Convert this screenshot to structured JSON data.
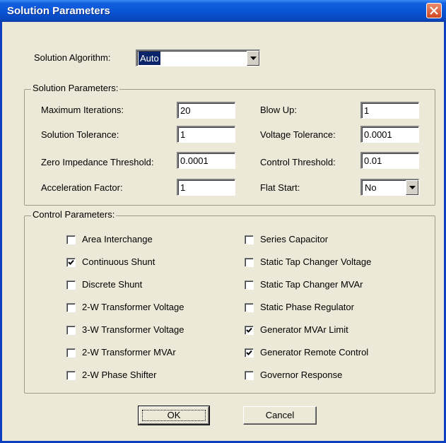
{
  "window": {
    "title": "Solution Parameters"
  },
  "algorithm": {
    "label": "Solution Algorithm:",
    "value": "Auto"
  },
  "solution_group": {
    "title": "Solution Parameters:",
    "max_iterations": {
      "label": "Maximum Iterations:",
      "value": "20"
    },
    "solution_tolerance": {
      "label": "Solution Tolerance:",
      "value": "1"
    },
    "zero_impedance": {
      "label": "Zero Impedance Threshold:",
      "value": "0.0001"
    },
    "acceleration": {
      "label": "Acceleration Factor:",
      "value": "1"
    },
    "blow_up": {
      "label": "Blow Up:",
      "value": "1"
    },
    "voltage_tolerance": {
      "label": "Voltage Tolerance:",
      "value": "0.0001"
    },
    "control_threshold": {
      "label": "Control Threshold:",
      "value": "0.01"
    },
    "flat_start": {
      "label": "Flat Start:",
      "value": "No"
    }
  },
  "control_group": {
    "title": "Control Parameters:",
    "left": [
      {
        "label": "Area Interchange",
        "checked": false
      },
      {
        "label": "Continuous Shunt",
        "checked": true
      },
      {
        "label": "Discrete Shunt",
        "checked": false
      },
      {
        "label": "2-W Transformer Voltage",
        "checked": false
      },
      {
        "label": "3-W Transformer Voltage",
        "checked": false
      },
      {
        "label": "2-W Transformer MVAr",
        "checked": false
      },
      {
        "label": "2-W Phase Shifter",
        "checked": false
      }
    ],
    "right": [
      {
        "label": "Series Capacitor",
        "checked": false
      },
      {
        "label": "Static Tap Changer Voltage",
        "checked": false
      },
      {
        "label": "Static Tap Changer MVAr",
        "checked": false
      },
      {
        "label": "Static Phase Regulator",
        "checked": false
      },
      {
        "label": "Generator MVAr Limit",
        "checked": true
      },
      {
        "label": "Generator Remote Control",
        "checked": true
      },
      {
        "label": "Governor Response",
        "checked": false
      }
    ]
  },
  "buttons": {
    "ok": "OK",
    "cancel": "Cancel"
  },
  "icons": {
    "close": "close-icon",
    "dropdown": "chevron-down-icon",
    "check": "check-icon"
  },
  "colors": {
    "titlebar": "#0a55d6",
    "close": "#d2461e",
    "face": "#ece9d8",
    "selection": "#0a246a"
  }
}
